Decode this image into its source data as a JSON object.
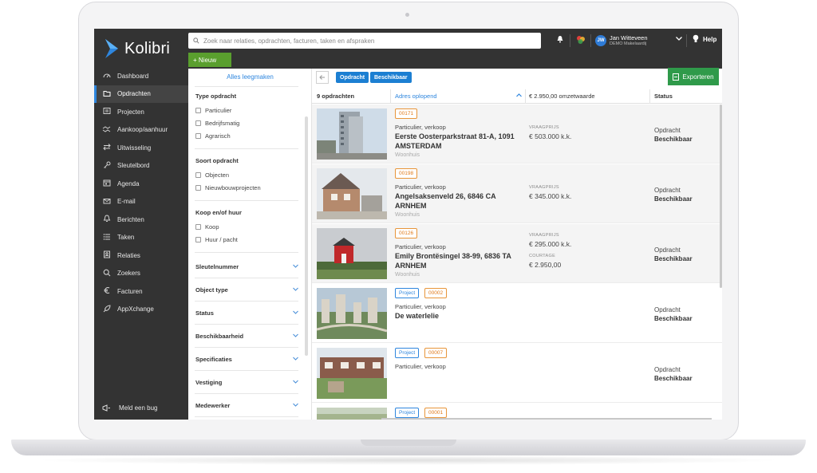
{
  "brand": {
    "name": "Kolibri"
  },
  "search": {
    "placeholder": "Zoek naar relaties, opdrachten, facturen, taken en afspraken"
  },
  "user": {
    "initials": "JW",
    "name": "Jan Witteveen",
    "org": "DEMO Makelaardij"
  },
  "header": {
    "help_label": "Help",
    "new_label": "+ Nieuw"
  },
  "sidebar": {
    "items": [
      {
        "label": "Dashboard",
        "icon": "dashboard-icon"
      },
      {
        "label": "Opdrachten",
        "icon": "folder-icon",
        "active": true
      },
      {
        "label": "Projecten",
        "icon": "projects-icon"
      },
      {
        "label": "Aankoop/aanhuur",
        "icon": "handshake-icon"
      },
      {
        "label": "Uitwisseling",
        "icon": "exchange-icon"
      },
      {
        "label": "Sleutelbord",
        "icon": "key-icon"
      },
      {
        "label": "Agenda",
        "icon": "calendar-icon"
      },
      {
        "label": "E-mail",
        "icon": "mail-icon"
      },
      {
        "label": "Berichten",
        "icon": "bell-icon"
      },
      {
        "label": "Taken",
        "icon": "tasks-icon"
      },
      {
        "label": "Relaties",
        "icon": "contacts-icon"
      },
      {
        "label": "Zoekers",
        "icon": "search-icon"
      },
      {
        "label": "Facturen",
        "icon": "euro-icon"
      },
      {
        "label": "AppXchange",
        "icon": "rocket-icon"
      }
    ],
    "bug_label": "Meld een bug"
  },
  "filters": {
    "clear_all": "Alles leegmaken",
    "type_opdracht": {
      "title": "Type opdracht",
      "options": [
        "Particulier",
        "Bedrijfsmatig",
        "Agrarisch"
      ]
    },
    "soort_opdracht": {
      "title": "Soort opdracht",
      "options": [
        "Objecten",
        "Nieuwbouwprojecten"
      ]
    },
    "koop_huur": {
      "title": "Koop en/of huur",
      "options": [
        "Koop",
        "Huur / pacht"
      ]
    },
    "accordions": [
      "Sleutelnummer",
      "Object type",
      "Status",
      "Beschikbaarheid",
      "Specificaties",
      "Vestiging",
      "Medewerker"
    ]
  },
  "toolbar": {
    "chips": [
      "Opdracht",
      "Beschikbaar"
    ],
    "export_label": "Exporteren"
  },
  "table": {
    "count": "9 opdrachten",
    "sort": "Adres oplopend",
    "total": "€ 2.950,00 omzetwaarde",
    "status_header": "Status",
    "rows": [
      {
        "badges": [
          {
            "kind": "code",
            "text": "00171"
          }
        ],
        "type": "Particulier, verkoop",
        "address": "Eerste Oosterparkstraat 81-A, 1091 AMSTERDAM",
        "sub": "Woonhuis",
        "prices": [
          {
            "label": "VRAAGPRIJS",
            "value": "€ 503.000 k.k."
          }
        ],
        "status1": "Opdracht",
        "status2": "Beschikbaar"
      },
      {
        "badges": [
          {
            "kind": "code",
            "text": "00198"
          }
        ],
        "type": "Particulier, verkoop",
        "address": "Angelsaksenveld 26, 6846 CA ARNHEM",
        "sub": "Woonhuis",
        "prices": [
          {
            "label": "VRAAGPRIJS",
            "value": "€ 345.000 k.k."
          }
        ],
        "status1": "Opdracht",
        "status2": "Beschikbaar"
      },
      {
        "badges": [
          {
            "kind": "code",
            "text": "00126"
          }
        ],
        "type": "Particulier, verkoop",
        "address": "Emily Brontësingel 38-99, 6836 TA ARNHEM",
        "sub": "Woonhuis",
        "prices": [
          {
            "label": "VRAAGPRIJS",
            "value": "€ 295.000 k.k."
          },
          {
            "label": "COURTAGE",
            "value": "€ 2.950,00"
          }
        ],
        "status1": "Opdracht",
        "status2": "Beschikbaar"
      },
      {
        "badges": [
          {
            "kind": "proj",
            "text": "Project"
          },
          {
            "kind": "code",
            "text": "00002"
          }
        ],
        "type": "Particulier, verkoop",
        "address": "De waterlelie",
        "sub": "",
        "prices": [],
        "status1": "Opdracht",
        "status2": "Beschikbaar"
      },
      {
        "badges": [
          {
            "kind": "proj",
            "text": "Project"
          },
          {
            "kind": "code",
            "text": "00007"
          }
        ],
        "type": "Particulier, verkoop",
        "address": "",
        "sub": "",
        "prices": [],
        "status1": "Opdracht",
        "status2": "Beschikbaar"
      },
      {
        "badges": [
          {
            "kind": "proj",
            "text": "Project"
          },
          {
            "kind": "code",
            "text": "00001"
          }
        ],
        "type": "",
        "address": "",
        "sub": "",
        "prices": [],
        "status1": "",
        "status2": ""
      }
    ]
  },
  "colors": {
    "dark": "#333333",
    "accent": "#2e86de",
    "green": "#5a9f2e",
    "export": "#2f9a4a",
    "orange": "#e07a1a"
  }
}
